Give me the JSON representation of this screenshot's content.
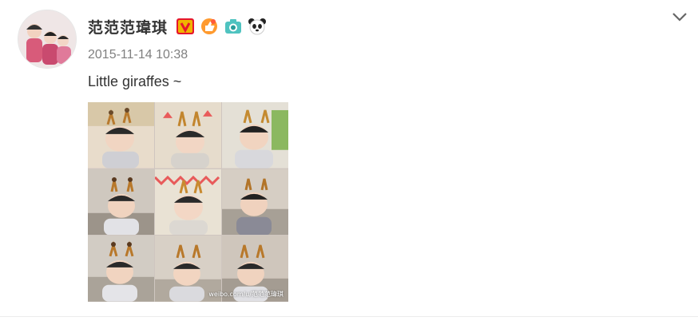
{
  "post": {
    "username": "范范范瑋琪",
    "timestamp": "2015-11-14 10:38",
    "text": "Little giraffes ~",
    "badges": [
      "verified-v-icon",
      "thumbs-up-badge-icon",
      "camera-badge-icon",
      "panda-badge-icon"
    ],
    "photo": {
      "watermark": "weibo.com/u/范范范瑋琪"
    }
  },
  "colors": {
    "verified": "#e6162d",
    "text_primary": "#333333",
    "text_secondary": "#808080"
  }
}
